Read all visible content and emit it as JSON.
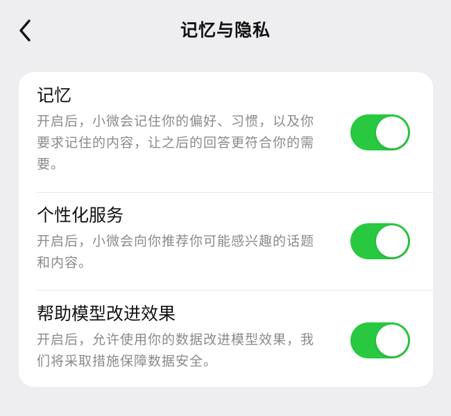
{
  "header": {
    "title": "记忆与隐私"
  },
  "settings": [
    {
      "title": "记忆",
      "description": "开启后，小微会记住你的偏好、习惯，以及你要求记住的内容，让之后的回答更符合你的需要。",
      "enabled": true
    },
    {
      "title": "个性化服务",
      "description": "开启后，小微会向你推荐你可能感兴趣的话题和内容。",
      "enabled": true
    },
    {
      "title": "帮助模型改进效果",
      "description": "开启后，允许使用你的数据改进模型效果，我们将采取措施保障数据安全。",
      "enabled": true
    }
  ],
  "colors": {
    "background": "#eeeef0",
    "card": "#ffffff",
    "toggle_on": "#28c840",
    "secondary_text": "#8a8a8a"
  },
  "icons": {
    "back": "chevron-left-icon"
  }
}
